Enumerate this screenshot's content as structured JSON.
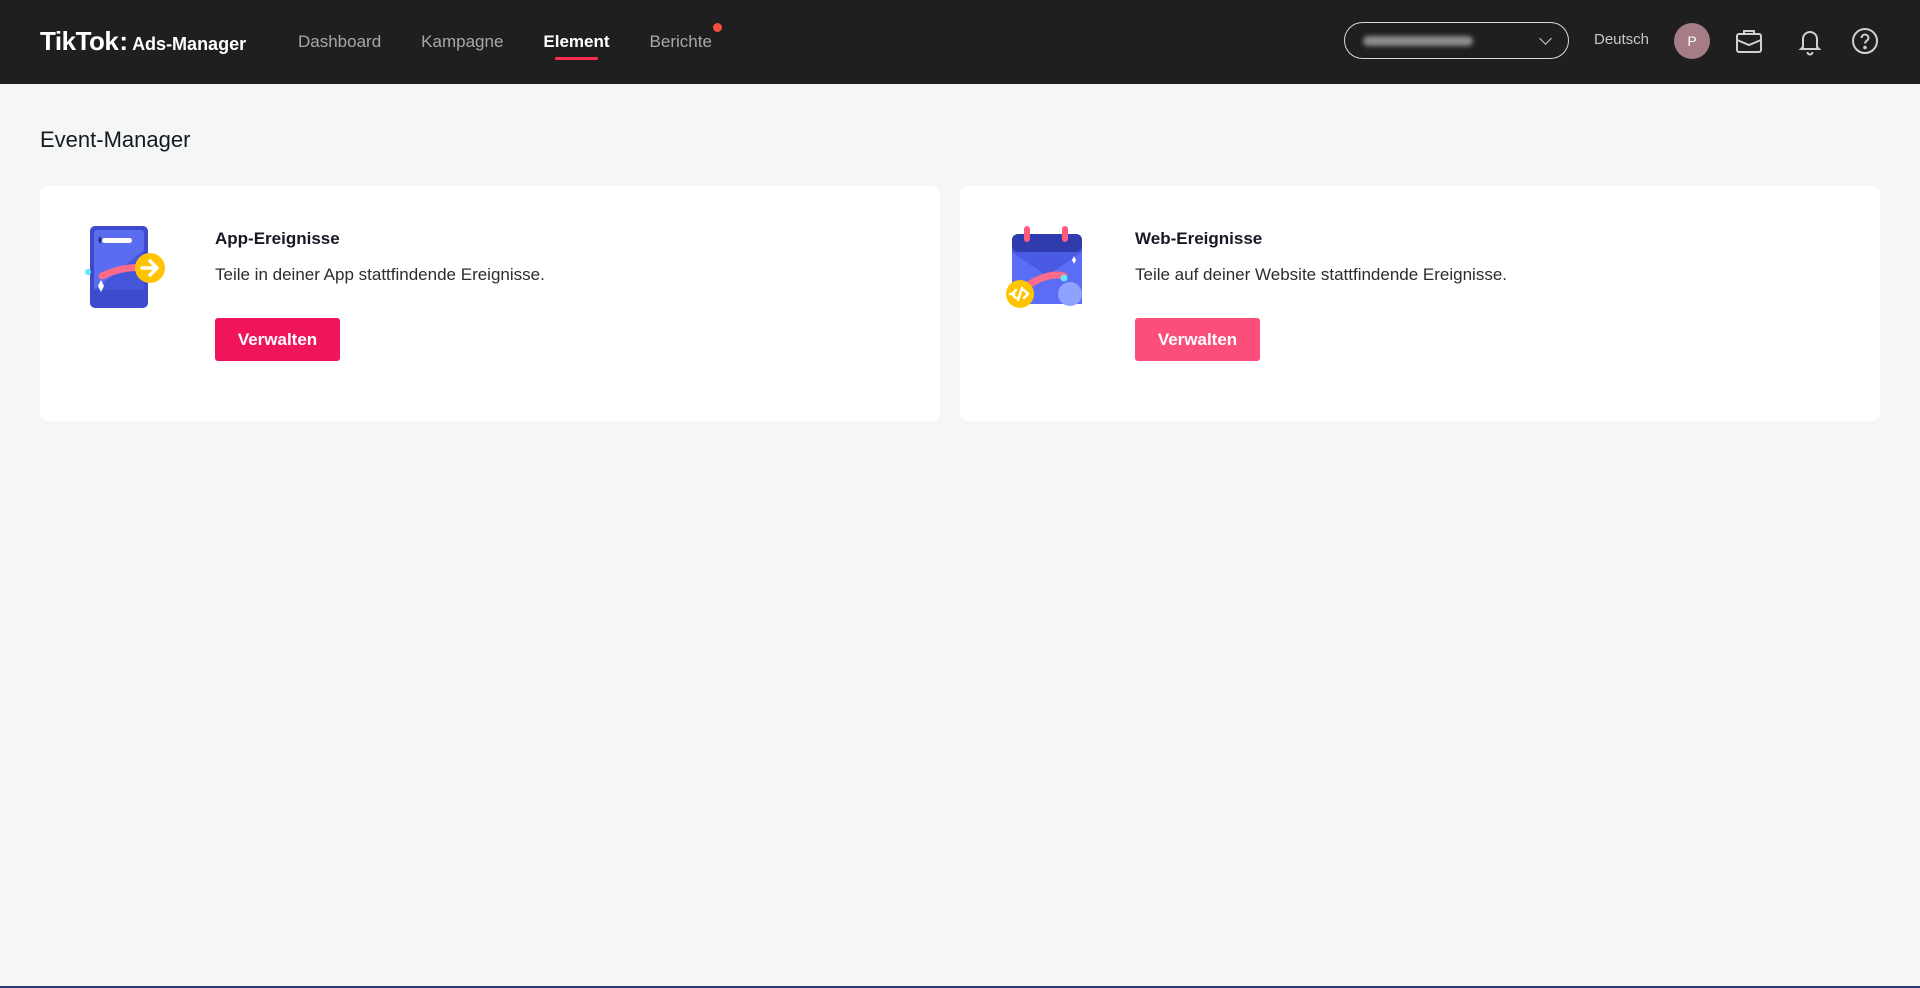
{
  "header": {
    "logo_main": "TikTok",
    "logo_sub": "Ads-Manager",
    "nav": [
      {
        "label": "Dashboard",
        "active": false
      },
      {
        "label": "Kampagne",
        "active": false
      },
      {
        "label": "Element",
        "active": true
      },
      {
        "label": "Berichte",
        "active": false,
        "badge": true
      }
    ],
    "language": "Deutsch",
    "avatar_initial": "P"
  },
  "page": {
    "title": "Event-Manager"
  },
  "cards": [
    {
      "title": "App-Ereignisse",
      "description": "Teile in deiner App stattfindende Ereignisse.",
      "button_label": "Verwalten",
      "icon": "app-events-icon",
      "button_color": "#f0155a"
    },
    {
      "title": "Web-Ereignisse",
      "description": "Teile auf deiner Website stattfindende Ereignisse.",
      "button_label": "Verwalten",
      "icon": "web-events-icon",
      "button_color": "#fb4e7a"
    }
  ],
  "colors": {
    "topbar": "#1f1f1f",
    "accent": "#fe2c55",
    "background": "#f5f6f6"
  }
}
